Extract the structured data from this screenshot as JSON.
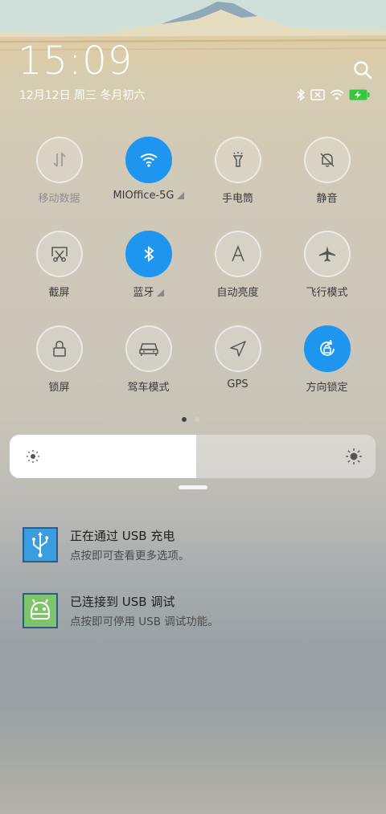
{
  "status": {
    "time": "15:09",
    "date": "12月12日 周三 冬月初六"
  },
  "icons": {
    "search": "search-icon",
    "bluetooth": "bluetooth-status-icon",
    "sim": "no-sim-icon",
    "wifi": "wifi-status-icon",
    "battery": "battery-charging-icon"
  },
  "colors": {
    "accent": "#1e96f0",
    "battery": "#35c940",
    "usb_icon_bg": "#3a9de0",
    "debug_icon_bg": "#7ec46b"
  },
  "toggles": [
    {
      "label": "移动数据",
      "icon": "mobile-data-icon",
      "active": false,
      "disabled": true
    },
    {
      "label": "MIOffice-5G",
      "icon": "wifi-icon",
      "active": true,
      "expandable": true
    },
    {
      "label": "手电筒",
      "icon": "flashlight-icon",
      "active": false
    },
    {
      "label": "静音",
      "icon": "mute-bell-icon",
      "active": false
    },
    {
      "label": "截屏",
      "icon": "screenshot-icon",
      "active": false
    },
    {
      "label": "蓝牙",
      "icon": "bluetooth-icon",
      "active": true,
      "expandable": true
    },
    {
      "label": "自动亮度",
      "icon": "auto-brightness-icon",
      "active": false
    },
    {
      "label": "飞行模式",
      "icon": "airplane-icon",
      "active": false
    },
    {
      "label": "锁屏",
      "icon": "lock-icon",
      "active": false
    },
    {
      "label": "驾车模式",
      "icon": "car-icon",
      "active": false
    },
    {
      "label": "GPS",
      "icon": "gps-icon",
      "active": false
    },
    {
      "label": "方向锁定",
      "icon": "rotation-lock-icon",
      "active": true
    }
  ],
  "pager": {
    "pages": 2,
    "current": 1
  },
  "brightness": {
    "level": 0.51
  },
  "notifications": [
    {
      "title": "正在通过 USB 充电",
      "text": "点按即可查看更多选项。",
      "icon": "usb-icon"
    },
    {
      "title": "已连接到 USB 调试",
      "text": "点按即可停用 USB 调试功能。",
      "icon": "android-debug-icon"
    }
  ]
}
